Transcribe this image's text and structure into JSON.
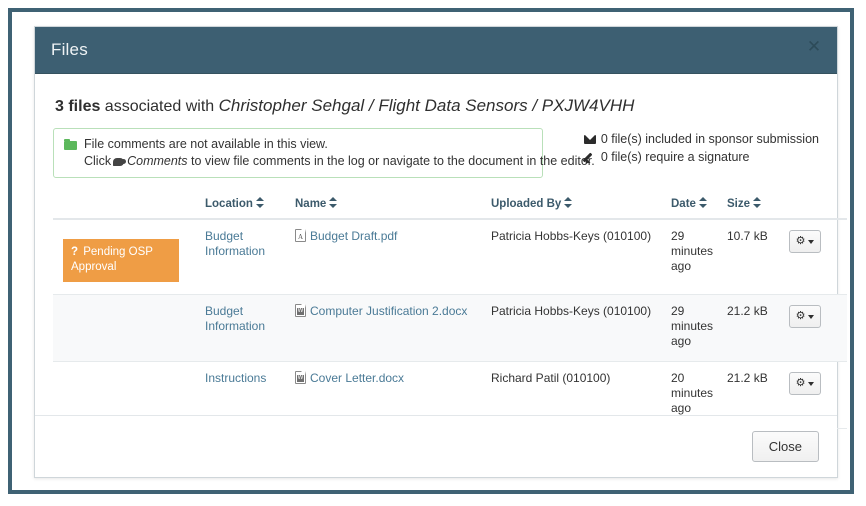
{
  "modal": {
    "title": "Files",
    "close_x": "✕"
  },
  "summary": {
    "count": "3 files",
    "assoc": " associated with ",
    "path": "Christopher Sehgal / Flight Data Sensors / PXJW4VHH"
  },
  "alert": {
    "icon": "folder-icon",
    "line1": "File comments are not available in this view.",
    "line2_pre": "Click",
    "line2_link": "Comments",
    "line2_post": "to view file comments in the log or navigate to the document in the editor."
  },
  "stats": [
    {
      "icon": "envelope-icon",
      "text": "0 file(s) included in sponsor submission"
    },
    {
      "icon": "pen-icon",
      "text": "0 file(s) require a signature"
    }
  ],
  "table": {
    "columns": [
      {
        "label": "",
        "sortable": false
      },
      {
        "label": "Location",
        "sortable": true
      },
      {
        "label": "Name",
        "sortable": true
      },
      {
        "label": "Uploaded By",
        "sortable": true
      },
      {
        "label": "Date",
        "sortable": true
      },
      {
        "label": "Size",
        "sortable": true
      },
      {
        "label": "",
        "sortable": false
      }
    ],
    "rows": [
      {
        "status": "Pending OSP Approval",
        "status_prefix": "?",
        "location": "Budget Information",
        "name": "Budget Draft.pdf",
        "file_type": "pdf",
        "uploaded_by": "Patricia Hobbs-Keys (010100)",
        "date": "29 minutes ago",
        "size": "10.7 kB",
        "action_label": "actions-menu"
      },
      {
        "status": "",
        "status_prefix": "",
        "location": "Budget Information",
        "name": "Computer Justification 2.docx",
        "file_type": "docx",
        "uploaded_by": "Patricia Hobbs-Keys (010100)",
        "date": "29 minutes ago",
        "size": "21.2 kB",
        "action_label": "actions-menu"
      },
      {
        "status": "",
        "status_prefix": "",
        "location": "Instructions",
        "name": "Cover Letter.docx",
        "file_type": "docx",
        "uploaded_by": "Richard Patil (010100)",
        "date": "20 minutes ago",
        "size": "21.2 kB",
        "action_label": "actions-menu"
      }
    ]
  },
  "footer": {
    "close_label": "Close"
  },
  "colors": {
    "header_bg": "#3d5f72",
    "frame_border": "#3f6274",
    "badge_orange": "#ef9d45",
    "link_blue": "#4a7a96",
    "alert_green": "#5cb85c"
  }
}
